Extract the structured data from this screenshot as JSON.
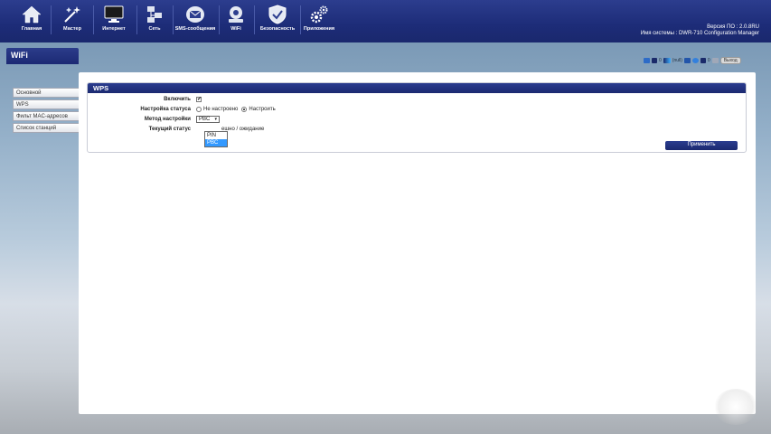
{
  "nav": [
    {
      "label": "Главная",
      "icon": "home-icon"
    },
    {
      "label": "Мастер",
      "icon": "wizard-icon"
    },
    {
      "label": "Интернет",
      "icon": "monitor-icon"
    },
    {
      "label": "Сеть",
      "icon": "network-icon"
    },
    {
      "label": "SMS-сообщения",
      "icon": "envelope-icon"
    },
    {
      "label": "WiFi",
      "icon": "wifi-router-icon"
    },
    {
      "label": "Безопасность",
      "icon": "shield-icon"
    },
    {
      "label": "Приложения",
      "icon": "gears-icon"
    }
  ],
  "firmware": {
    "version_line": "Версия ПО : 2.0.8RU",
    "system_line": "Имя системы : DWR-710 Configuration Manager"
  },
  "section_title": "WiFi",
  "status": {
    "sms_count": "0",
    "signal_text": "(null)",
    "data_count": "0",
    "logout_label": "Выход"
  },
  "menu": [
    "Основной",
    "WPS",
    "Фильт MAC-адресов",
    "Список станций"
  ],
  "wps": {
    "title": "WPS",
    "enable_label": "Включить",
    "status_label": "Настройка статуса",
    "status_options": [
      "Не настроено",
      "Настроить"
    ],
    "method_label": "Метод настройки",
    "method_value": "PBC",
    "method_options": [
      "PIN",
      "PBC"
    ],
    "current_label": "Текущий статус",
    "current_value": "ешно / ожидание",
    "apply_label": "Применить"
  },
  "colors": {
    "topbar": "#1d2c78",
    "accent": "#2b3d8f",
    "selected": "#3399ff"
  }
}
